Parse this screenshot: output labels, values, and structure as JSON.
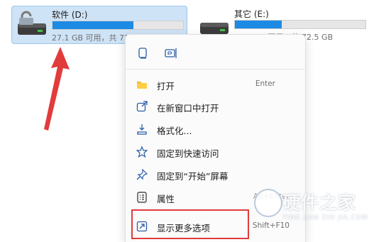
{
  "drives": [
    {
      "name": "软件 (D:)",
      "space": "27.1 GB 可用，共 71.9 GB",
      "used_fraction": 0.62,
      "selected": true,
      "icon": "hard-drive-icon"
    },
    {
      "name": "其它 (E:)",
      "space": "46.4 GB 可用，共 72.5 GB",
      "used_fraction": 0.36,
      "selected": false,
      "icon": "hard-drive-icon"
    }
  ],
  "context_menu": {
    "quick_actions": [
      {
        "name": "copy-button",
        "icon": "copy-icon"
      },
      {
        "name": "rename-button",
        "icon": "rename-icon"
      }
    ],
    "items": [
      {
        "label": "打开",
        "shortcut": "Enter",
        "icon": "folder-open-icon"
      },
      {
        "label": "在新窗口中打开",
        "shortcut": "",
        "icon": "open-new-window-icon"
      },
      {
        "label": "格式化...",
        "shortcut": "",
        "icon": "format-drive-icon"
      },
      {
        "label": "固定到快速访问",
        "shortcut": "",
        "icon": "star-icon"
      },
      {
        "label": "固定到“开始”屏幕",
        "shortcut": "",
        "icon": "pin-icon"
      },
      {
        "label": "属性",
        "shortcut": "Alt+Enter",
        "icon": "properties-icon"
      },
      {
        "label": "显示更多选项",
        "shortcut": "Shift+F10",
        "icon": "show-more-icon"
      }
    ]
  },
  "watermark": {
    "title": "硬件之家",
    "subtitle": "YING JIAN ZHI JIA.COM"
  },
  "colors": {
    "accent": "#1d8ae3",
    "selection": "#cfe3f6",
    "annotation": "#e23b3b"
  }
}
